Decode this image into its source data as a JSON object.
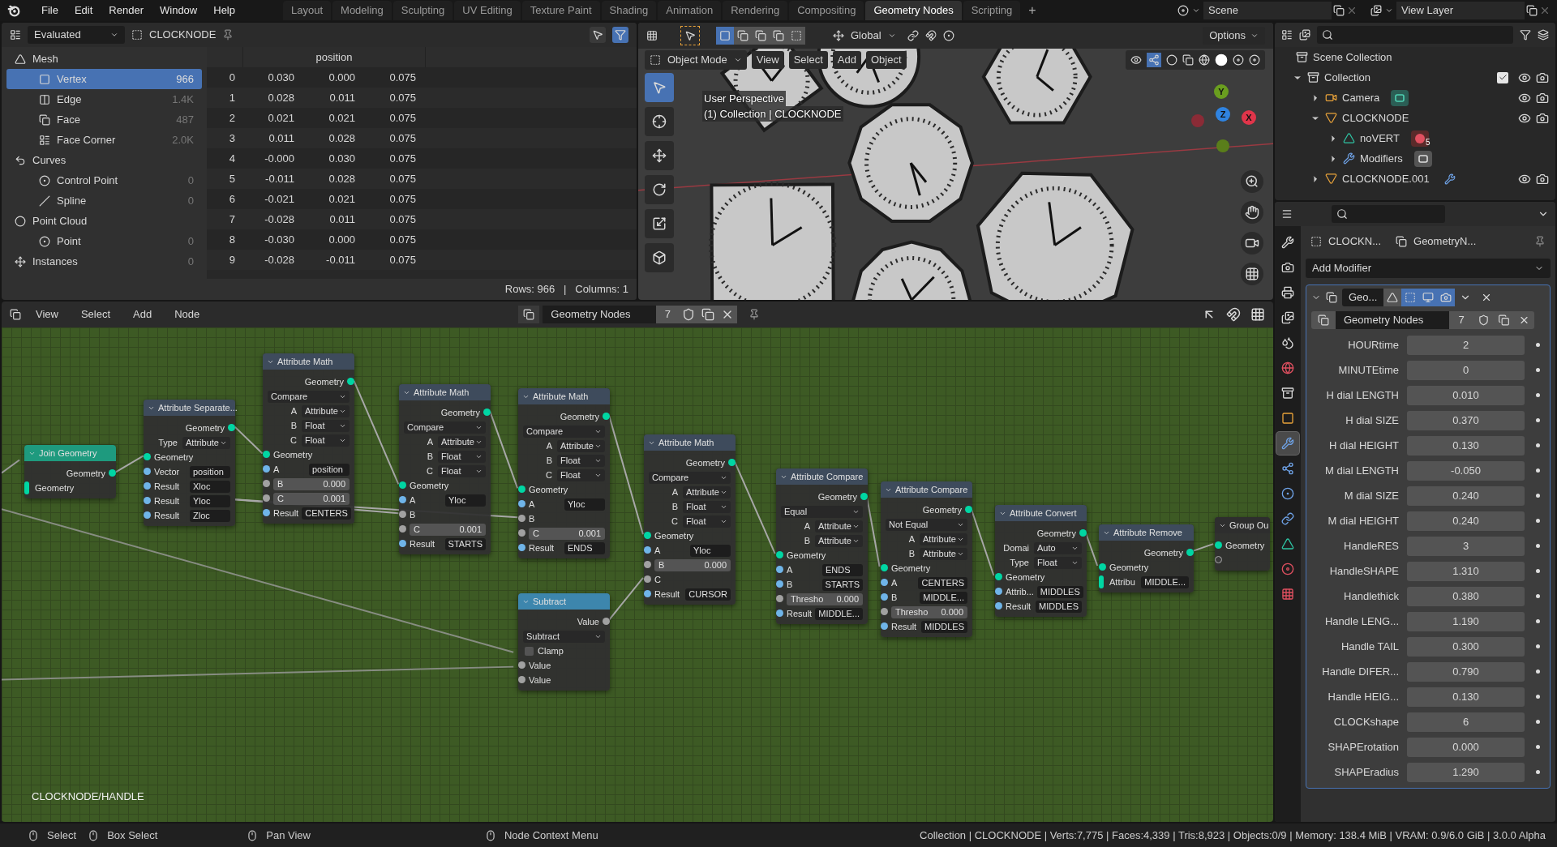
{
  "menu_bar": {
    "menus": [
      "File",
      "Edit",
      "Render",
      "Window",
      "Help"
    ],
    "workspaces": [
      {
        "label": "Layout",
        "selected": false
      },
      {
        "label": "Modeling",
        "selected": false
      },
      {
        "label": "Sculpting",
        "selected": false
      },
      {
        "label": "UV Editing",
        "selected": false
      },
      {
        "label": "Texture Paint",
        "selected": false
      },
      {
        "label": "Shading",
        "selected": false
      },
      {
        "label": "Animation",
        "selected": false
      },
      {
        "label": "Rendering",
        "selected": false
      },
      {
        "label": "Compositing",
        "selected": false
      },
      {
        "label": "Geometry Nodes",
        "selected": true
      },
      {
        "label": "Scripting",
        "selected": false
      }
    ],
    "add_tab": "+",
    "scene": "Scene",
    "view_layer": "View Layer"
  },
  "spreadsheet": {
    "mode": "Evaluated",
    "object": "CLOCKNODE",
    "domains": [
      {
        "label": "Mesh",
        "kind": "mesh",
        "selected": false,
        "children": [
          {
            "label": "Vertex",
            "kind": "vertex",
            "count": "966",
            "selected": true
          },
          {
            "label": "Edge",
            "kind": "edge",
            "count": "1.4K",
            "selected": false
          },
          {
            "label": "Face",
            "kind": "face",
            "count": "487",
            "selected": false
          },
          {
            "label": "Face Corner",
            "kind": "corner",
            "count": "2.0K",
            "selected": false
          }
        ]
      },
      {
        "label": "Curves",
        "kind": "curves",
        "selected": false,
        "children": [
          {
            "label": "Control Point",
            "kind": "control_point",
            "count": "0",
            "selected": false
          },
          {
            "label": "Spline",
            "kind": "spline",
            "count": "0",
            "selected": false
          }
        ]
      },
      {
        "label": "Point Cloud",
        "kind": "point_cloud",
        "selected": false,
        "children": [
          {
            "label": "Point",
            "kind": "point",
            "count": "0",
            "selected": false
          }
        ]
      },
      {
        "label": "Instances",
        "kind": "instances",
        "count": "0",
        "selected": false
      }
    ],
    "column": "position",
    "rows": [
      {
        "index": "0",
        "values": [
          "0.030",
          "0.000",
          "0.075"
        ]
      },
      {
        "index": "1",
        "values": [
          "0.028",
          "0.011",
          "0.075"
        ]
      },
      {
        "index": "2",
        "values": [
          "0.021",
          "0.021",
          "0.075"
        ]
      },
      {
        "index": "3",
        "values": [
          "0.011",
          "0.028",
          "0.075"
        ]
      },
      {
        "index": "4",
        "values": [
          "-0.000",
          "0.030",
          "0.075"
        ]
      },
      {
        "index": "5",
        "values": [
          "-0.011",
          "0.028",
          "0.075"
        ]
      },
      {
        "index": "6",
        "values": [
          "-0.021",
          "0.021",
          "0.075"
        ]
      },
      {
        "index": "7",
        "values": [
          "-0.028",
          "0.011",
          "0.075"
        ]
      },
      {
        "index": "8",
        "values": [
          "-0.030",
          "0.000",
          "0.075"
        ]
      },
      {
        "index": "9",
        "values": [
          "-0.028",
          "-0.011",
          "0.075"
        ]
      }
    ],
    "footer": "Rows: 966   |   Columns: 1"
  },
  "viewport": {
    "orientation": "Global",
    "options": "Options",
    "mode": "Object Mode",
    "menus": [
      "View",
      "Select",
      "Add",
      "Object"
    ],
    "info": [
      "User Perspective",
      "(1) Collection | CLOCKNODE"
    ],
    "tools": [
      {
        "kind": "select",
        "selected": true
      },
      {
        "kind": "cursor",
        "selected": false
      },
      {
        "kind": "move",
        "selected": false
      },
      {
        "kind": "rotate",
        "selected": false
      },
      {
        "kind": "scale",
        "selected": false
      },
      {
        "kind": "transform",
        "selected": false
      }
    ],
    "gizmo_axes": [
      {
        "label": "Y",
        "color": "#6a9e1f"
      },
      {
        "label": "Z",
        "color": "#2f83e0"
      },
      {
        "label": "X",
        "color": "#e0354a"
      }
    ]
  },
  "outliner": {
    "items": [
      {
        "label": "Scene Collection",
        "kind": "scene",
        "children": [
          {
            "label": "Collection",
            "kind": "collection",
            "expanded": true,
            "checked": true,
            "children": [
              {
                "label": "Camera",
                "kind": "camera",
                "expanded": false,
                "badge": {
                  "kind": "camera_data"
                }
              },
              {
                "label": "CLOCKNODE",
                "kind": "mesh",
                "expanded": true,
                "children": [
                  {
                    "label": "noVERT",
                    "kind": "mesh_data",
                    "expanded": false,
                    "badge": {
                      "kind": "material",
                      "count": "5"
                    }
                  },
                  {
                    "label": "Modifiers",
                    "kind": "modifiers",
                    "expanded": false,
                    "badge": {
                      "kind": "modifier"
                    }
                  }
                ]
              },
              {
                "label": "CLOCKNODE.001",
                "kind": "mesh",
                "expanded": false,
                "badge": {
                  "kind": "wrench"
                }
              }
            ]
          }
        ]
      }
    ]
  },
  "properties": {
    "tabs": [
      {
        "kind": "tool",
        "selected": false
      },
      {
        "kind": "render",
        "selected": false
      },
      {
        "kind": "output",
        "selected": false
      },
      {
        "kind": "view_layer",
        "selected": false
      },
      {
        "kind": "scene",
        "selected": false
      },
      {
        "kind": "world",
        "selected": false
      },
      {
        "kind": "collection",
        "selected": false
      },
      {
        "kind": "object",
        "selected": false
      },
      {
        "kind": "modifiers",
        "selected": true
      },
      {
        "kind": "particles",
        "selected": false
      },
      {
        "kind": "physics",
        "selected": false
      },
      {
        "kind": "constraints",
        "selected": false
      },
      {
        "kind": "data",
        "selected": false
      },
      {
        "kind": "material",
        "selected": false
      },
      {
        "kind": "texture",
        "selected": false
      }
    ],
    "object": "CLOCKN...",
    "modifier_path": "GeometryN...",
    "add_modifier": "Add Modifier",
    "modifier": {
      "name": "Geo...",
      "node_group": "Geometry Nodes",
      "users": "7",
      "inputs": [
        {
          "label": "HOURtime",
          "value": "2"
        },
        {
          "label": "MINUTEtime",
          "value": "0"
        },
        {
          "label": "H dial LENGTH",
          "value": "0.010"
        },
        {
          "label": "H dial SIZE",
          "value": "0.370"
        },
        {
          "label": "H dial HEIGHT",
          "value": "0.130"
        },
        {
          "label": "M dial LENGTH",
          "value": "-0.050"
        },
        {
          "label": "M dial SIZE",
          "value": "0.240"
        },
        {
          "label": "M dial HEIGHT",
          "value": "0.240"
        },
        {
          "label": "HandleRES",
          "value": "3"
        },
        {
          "label": "HandleSHAPE",
          "value": "1.310"
        },
        {
          "label": "Handlethick",
          "value": "0.380"
        },
        {
          "label": "Handle LENG...",
          "value": "1.190"
        },
        {
          "label": "Handle TAIL",
          "value": "0.300"
        },
        {
          "label": "Handle DIFER...",
          "value": "0.790"
        },
        {
          "label": "Handle HEIG...",
          "value": "0.130"
        },
        {
          "label": "CLOCKshape",
          "value": "6"
        },
        {
          "label": "SHAPErotation",
          "value": "0.000"
        },
        {
          "label": "SHAPEradius",
          "value": "1.290"
        }
      ]
    }
  },
  "node_editor": {
    "menus": [
      "View",
      "Select",
      "Add",
      "Node"
    ],
    "tree_name": "Geometry Nodes",
    "users": "7",
    "breadcrumb": "CLOCKNODE/HANDLE",
    "nodes": [
      {
        "title": "Join Geometry",
        "kind": "geometry",
        "rows": [
          {
            "kind": "out",
            "label": "Geometry",
            "socket": {
              "kind": "geometry"
            }
          },
          {
            "kind": "in",
            "label": "Geometry",
            "socket": {
              "kind": "multi"
            }
          }
        ]
      },
      {
        "title": "Attribute Separate...",
        "kind": "attribute",
        "rows": [
          {
            "kind": "out",
            "label": "Geometry",
            "socket": {
              "kind": "geometry"
            }
          },
          {
            "kind": "prop",
            "label": "Type",
            "value": "Attribute"
          },
          {
            "kind": "in",
            "label": "Geometry",
            "socket": {
              "kind": "geometry"
            }
          },
          {
            "kind": "field",
            "label": "Vector",
            "value": "position",
            "socket": {
              "kind": "attribute"
            }
          },
          {
            "kind": "field",
            "label": "Result",
            "value": "Xloc",
            "socket": {
              "kind": "attribute"
            }
          },
          {
            "kind": "field",
            "label": "Result",
            "value": "Yloc",
            "socket": {
              "kind": "attribute"
            }
          },
          {
            "kind": "field",
            "label": "Result",
            "value": "Zloc",
            "socket": {
              "kind": "attribute"
            }
          }
        ]
      },
      {
        "title": "Attribute Math",
        "kind": "attribute",
        "rows": [
          {
            "kind": "out",
            "label": "Geometry",
            "socket": {
              "kind": "geometry"
            }
          },
          {
            "kind": "menu",
            "value": "Compare"
          },
          {
            "kind": "prop",
            "label": "A",
            "value": "Attribute"
          },
          {
            "kind": "prop",
            "label": "B",
            "value": "Float"
          },
          {
            "kind": "prop",
            "label": "C",
            "value": "Float"
          },
          {
            "kind": "in",
            "label": "Geometry",
            "socket": {
              "kind": "geometry"
            }
          },
          {
            "kind": "field",
            "label": "A",
            "value": "position",
            "socket": {
              "kind": "attribute"
            }
          },
          {
            "kind": "number",
            "label": "B",
            "value": "0.000",
            "socket": {
              "kind": "float"
            }
          },
          {
            "kind": "number",
            "label": "C",
            "value": "0.001",
            "socket": {
              "kind": "float"
            }
          },
          {
            "kind": "field",
            "label": "Result",
            "value": "CENTERS",
            "socket": {
              "kind": "attribute"
            }
          }
        ]
      },
      {
        "title": "Attribute Math",
        "kind": "attribute",
        "rows": [
          {
            "kind": "out",
            "label": "Geometry",
            "socket": {
              "kind": "geometry"
            }
          },
          {
            "kind": "menu",
            "value": "Compare"
          },
          {
            "kind": "prop",
            "label": "A",
            "value": "Attribute"
          },
          {
            "kind": "prop",
            "label": "B",
            "value": "Float"
          },
          {
            "kind": "prop",
            "label": "C",
            "value": "Float"
          },
          {
            "kind": "in",
            "label": "Geometry",
            "socket": {
              "kind": "geometry"
            }
          },
          {
            "kind": "field",
            "label": "A",
            "value": "Yloc",
            "socket": {
              "kind": "attribute"
            }
          },
          {
            "kind": "in",
            "label": "B",
            "socket": {
              "kind": "float"
            }
          },
          {
            "kind": "number",
            "label": "C",
            "value": "0.001",
            "socket": {
              "kind": "float"
            }
          },
          {
            "kind": "field",
            "label": "Result",
            "value": "STARTS",
            "socket": {
              "kind": "attribute"
            }
          }
        ]
      },
      {
        "title": "Attribute Math",
        "kind": "attribute",
        "rows": [
          {
            "kind": "out",
            "label": "Geometry",
            "socket": {
              "kind": "geometry"
            }
          },
          {
            "kind": "menu",
            "value": "Compare"
          },
          {
            "kind": "prop",
            "label": "A",
            "value": "Attribute"
          },
          {
            "kind": "prop",
            "label": "B",
            "value": "Float"
          },
          {
            "kind": "prop",
            "label": "C",
            "value": "Float"
          },
          {
            "kind": "in",
            "label": "Geometry",
            "socket": {
              "kind": "geometry"
            }
          },
          {
            "kind": "field",
            "label": "A",
            "value": "Yloc",
            "socket": {
              "kind": "attribute"
            }
          },
          {
            "kind": "in",
            "label": "B",
            "socket": {
              "kind": "float"
            }
          },
          {
            "kind": "number",
            "label": "C",
            "value": "0.001",
            "socket": {
              "kind": "float"
            }
          },
          {
            "kind": "field",
            "label": "Result",
            "value": "ENDS",
            "socket": {
              "kind": "attribute"
            }
          }
        ]
      },
      {
        "title": "Subtract",
        "kind": "math",
        "rows": [
          {
            "kind": "out",
            "label": "Value",
            "socket": {
              "kind": "float"
            }
          },
          {
            "kind": "menu",
            "value": "Subtract"
          },
          {
            "kind": "check",
            "label": "Clamp",
            "checked": false
          },
          {
            "kind": "in",
            "label": "Value",
            "socket": {
              "kind": "float"
            }
          },
          {
            "kind": "in",
            "label": "Value",
            "socket": {
              "kind": "float"
            }
          }
        ]
      },
      {
        "title": "Attribute Math",
        "kind": "attribute",
        "rows": [
          {
            "kind": "out",
            "label": "Geometry",
            "socket": {
              "kind": "geometry"
            }
          },
          {
            "kind": "menu",
            "value": "Compare"
          },
          {
            "kind": "prop",
            "label": "A",
            "value": "Attribute"
          },
          {
            "kind": "prop",
            "label": "B",
            "value": "Float"
          },
          {
            "kind": "prop",
            "label": "C",
            "value": "Float"
          },
          {
            "kind": "in",
            "label": "Geometry",
            "socket": {
              "kind": "geometry"
            }
          },
          {
            "kind": "field",
            "label": "A",
            "value": "Yloc",
            "socket": {
              "kind": "attribute"
            }
          },
          {
            "kind": "number",
            "label": "B",
            "value": "0.000",
            "socket": {
              "kind": "float"
            }
          },
          {
            "kind": "in",
            "label": "C",
            "socket": {
              "kind": "float"
            }
          },
          {
            "kind": "field",
            "label": "Result",
            "value": "CURSOR",
            "socket": {
              "kind": "attribute"
            }
          }
        ]
      },
      {
        "title": "Attribute Compare",
        "kind": "attribute",
        "rows": [
          {
            "kind": "out",
            "label": "Geometry",
            "socket": {
              "kind": "geometry"
            }
          },
          {
            "kind": "menu",
            "value": "Equal"
          },
          {
            "kind": "prop",
            "label": "A",
            "value": "Attribute"
          },
          {
            "kind": "prop",
            "label": "B",
            "value": "Attribute"
          },
          {
            "kind": "in",
            "label": "Geometry",
            "socket": {
              "kind": "geometry"
            }
          },
          {
            "kind": "field",
            "label": "A",
            "value": "ENDS",
            "socket": {
              "kind": "attribute"
            }
          },
          {
            "kind": "field",
            "label": "B",
            "value": "STARTS",
            "socket": {
              "kind": "attribute"
            }
          },
          {
            "kind": "number",
            "label": "Thresho",
            "value": "0.000",
            "socket": {
              "kind": "float"
            }
          },
          {
            "kind": "field",
            "label": "Result",
            "value": "MIDDLE...",
            "socket": {
              "kind": "attribute"
            }
          }
        ]
      },
      {
        "title": "Attribute Compare",
        "kind": "attribute",
        "rows": [
          {
            "kind": "out",
            "label": "Geometry",
            "socket": {
              "kind": "geometry"
            }
          },
          {
            "kind": "menu",
            "value": "Not Equal"
          },
          {
            "kind": "prop",
            "label": "A",
            "value": "Attribute"
          },
          {
            "kind": "prop",
            "label": "B",
            "value": "Attribute"
          },
          {
            "kind": "in",
            "label": "Geometry",
            "socket": {
              "kind": "geometry"
            }
          },
          {
            "kind": "field",
            "label": "A",
            "value": "CENTERS",
            "socket": {
              "kind": "attribute"
            }
          },
          {
            "kind": "field",
            "label": "B",
            "value": "MIDDLE...",
            "socket": {
              "kind": "attribute"
            }
          },
          {
            "kind": "number",
            "label": "Thresho",
            "value": "0.000",
            "socket": {
              "kind": "float"
            }
          },
          {
            "kind": "field",
            "label": "Result",
            "value": "MIDDLES",
            "socket": {
              "kind": "attribute"
            }
          }
        ]
      },
      {
        "title": "Attribute Convert",
        "kind": "attribute",
        "rows": [
          {
            "kind": "out",
            "label": "Geometry",
            "socket": {
              "kind": "geometry"
            }
          },
          {
            "kind": "prop",
            "label": "Domai",
            "value": "Auto"
          },
          {
            "kind": "prop",
            "label": "Type",
            "value": "Float"
          },
          {
            "kind": "in",
            "label": "Geometry",
            "socket": {
              "kind": "geometry"
            }
          },
          {
            "kind": "field",
            "label": "Attrib...",
            "value": "MIDDLES",
            "socket": {
              "kind": "attribute"
            }
          },
          {
            "kind": "field",
            "label": "Result",
            "value": "MIDDLES",
            "socket": {
              "kind": "attribute"
            }
          }
        ]
      },
      {
        "title": "Attribute Remove",
        "kind": "attribute",
        "rows": [
          {
            "kind": "out",
            "label": "Geometry",
            "socket": {
              "kind": "geometry"
            }
          },
          {
            "kind": "in",
            "label": "Geometry",
            "socket": {
              "kind": "geometry"
            }
          },
          {
            "kind": "field",
            "label": "Attribu",
            "value": "MIDDLE...",
            "socket": {
              "kind": "multi"
            }
          }
        ]
      },
      {
        "title": "Group Ou",
        "kind": "group",
        "rows": [
          {
            "kind": "in",
            "label": "Geometry",
            "socket": {
              "kind": "geometry"
            }
          },
          {
            "kind": "socket",
            "socket": {
              "kind": "empty"
            }
          }
        ]
      }
    ]
  },
  "status_bar": {
    "hints": [
      "Select",
      "Box Select",
      "Pan View",
      "Node Context Menu"
    ],
    "stats": "Collection | CLOCKNODE | Verts:7,775 | Faces:4,339 | Tris:8,923 | Objects:0/9 | Memory: 138.4 MiB | VRAM: 0.9/6.0 GiB | 3.0.0 Alpha"
  }
}
